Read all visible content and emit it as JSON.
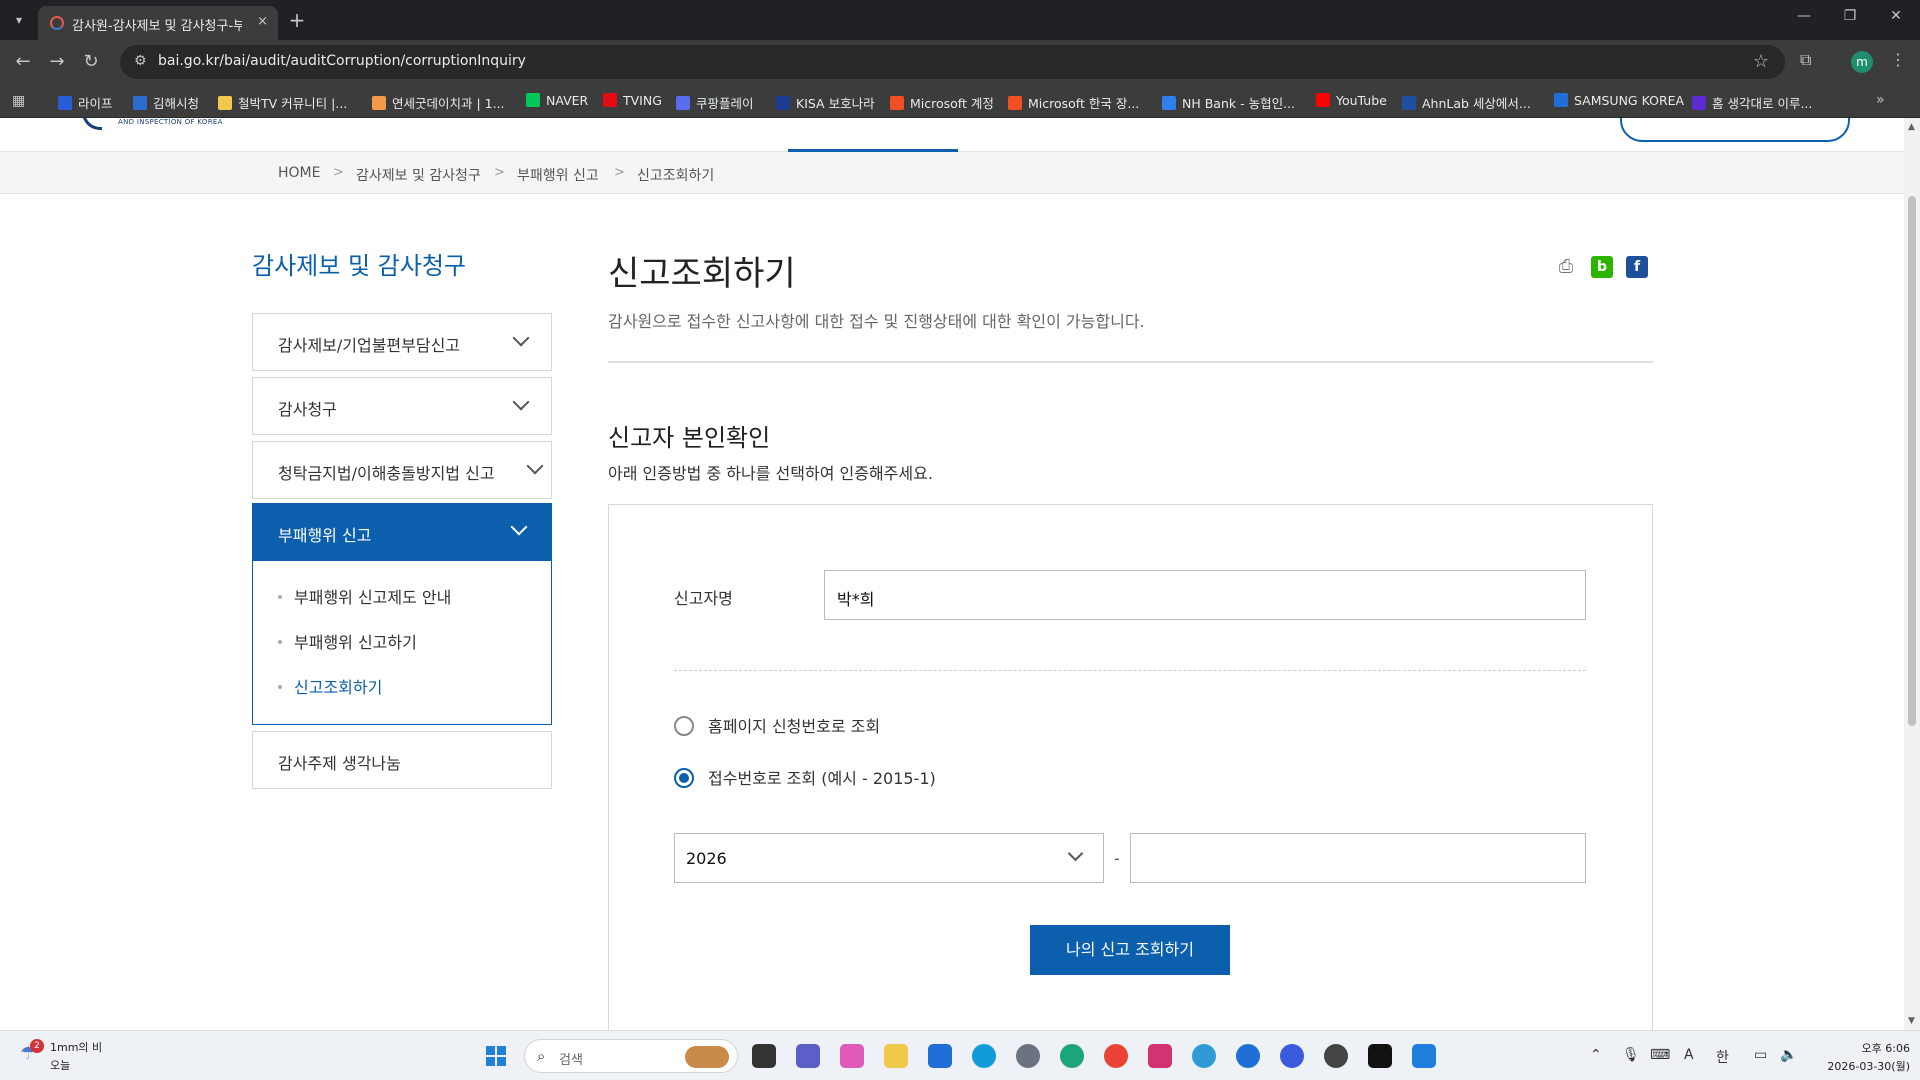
{
  "browser": {
    "tab_title": "감사원-감사제보 및 감사청구-부패행위 신고",
    "tab_close": "×",
    "new_tab": "+",
    "url": "bai.go.kr/bai/audit/auditCorruption/corruptionInquiry",
    "window_controls": [
      "—",
      "❐",
      "✕"
    ]
  },
  "bookmarks": [
    {
      "label": "라이프",
      "color": "#2a5bd7"
    },
    {
      "label": "김해시청",
      "color": "#2d6bd1"
    },
    {
      "label": "철박TV 커뮤니티 |...",
      "color": "#f2c94c"
    },
    {
      "label": "연세굿데이치과 | 1...",
      "color": "#f2994a"
    },
    {
      "label": "NAVER",
      "color": "#03c75a"
    },
    {
      "label": "TVING",
      "color": "#e50914"
    },
    {
      "label": "쿠팡플레이",
      "color": "#5a6cf0"
    },
    {
      "label": "KISA 보호나라",
      "color": "#1f3a93"
    },
    {
      "label": "Microsoft 계정",
      "color": "#f25022"
    },
    {
      "label": "Microsoft 한국 장...",
      "color": "#f25022"
    },
    {
      "label": "NH Bank - 농협인...",
      "color": "#2f80ed"
    },
    {
      "label": "YouTube",
      "color": "#ff0000"
    },
    {
      "label": "AhnLab  세상에서...",
      "color": "#1e4fa3"
    },
    {
      "label": "SAMSUNG KOREA",
      "color": "#1f6fd6"
    },
    {
      "label": "홈  생각대로 이루...",
      "color": "#5b2bd1"
    }
  ],
  "breadcrumb": {
    "items": [
      "HOME",
      "감사제보 및 감사청구",
      "부패행위 신고",
      "신고조회하기"
    ],
    "separator": ">"
  },
  "sidebar": {
    "title": "감사제보 및 감사청구",
    "items": [
      {
        "label": "감사제보/기업불편부담신고"
      },
      {
        "label": "감사청구"
      },
      {
        "label": "청탁금지법/이해충돌방지법 신고"
      },
      {
        "label": "부패행위 신고"
      },
      {
        "label": "감사주제 생각나눔"
      }
    ],
    "sub_items": [
      {
        "label": "부패행위 신고제도 안내"
      },
      {
        "label": "부패행위 신고하기"
      },
      {
        "label": "신고조회하기"
      }
    ]
  },
  "main": {
    "title": "신고조회하기",
    "description": "감사원으로 접수한 신고사항에 대한 접수 및 진행상태에 대한 확인이 가능합니다.",
    "share": {
      "print": "print-icon",
      "blog": "b",
      "facebook": "f"
    },
    "section_title": "신고자 본인확인",
    "section_desc": "아래 인증방법 중 하나를 선택하여 인증해주세요.",
    "form": {
      "name_label": "신고자명",
      "name_value": "박*희",
      "radio_options": [
        {
          "label": "홈페이지 신청번호로 조회",
          "checked": false
        },
        {
          "label": "접수번호로 조회 (예시 - 2015-1)",
          "checked": true
        }
      ],
      "year_value": "2026",
      "dash": "-",
      "number_value": "",
      "submit_label": "나의 신고 조회하기"
    }
  },
  "taskbar": {
    "weather_badge": "2",
    "weather_line1": "1mm의 비",
    "weather_line2": "오늘",
    "search_placeholder": "검색",
    "ime": "한",
    "font_indicator": "A",
    "clock_time": "오후 6:06",
    "clock_date": "2026-03-30(월)"
  },
  "colors": {
    "primary": "#0b5fad",
    "chrome_dark": "#3c3c3c"
  }
}
